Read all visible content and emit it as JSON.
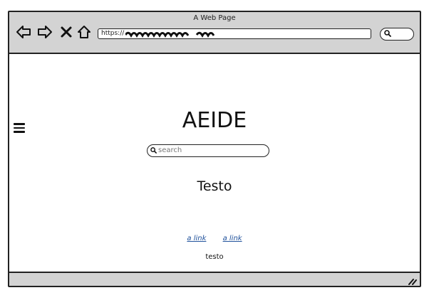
{
  "window": {
    "title": "A Web Page"
  },
  "toolbar": {
    "back": "back-arrow-icon",
    "forward": "forward-arrow-icon",
    "stop": "close-icon",
    "home": "home-icon"
  },
  "address_bar": {
    "url_prefix": "https://"
  },
  "page": {
    "logo": "AEIDE",
    "search_placeholder": "search",
    "heading": "Testo",
    "links": [
      "a link",
      "a link"
    ],
    "footer_text": "testo"
  }
}
